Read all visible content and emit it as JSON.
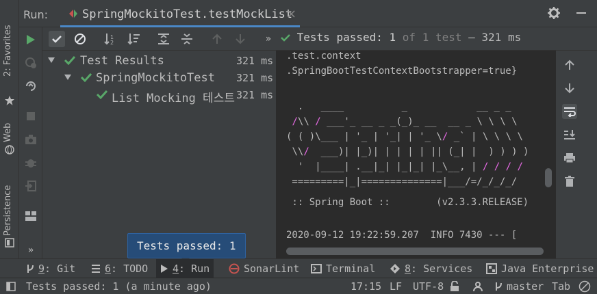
{
  "run_header": {
    "label": "Run:",
    "tab_title": "SpringMockitoTest.testMockList",
    "tab_close": "×"
  },
  "side_tabs": {
    "favorites": "2: Favorites",
    "web": "Web",
    "persistence": "Persistence"
  },
  "toolbar": {
    "expand_more": "»",
    "status_passed": "Tests passed:",
    "status_count": "1",
    "status_of": "of 1 test",
    "status_time": "– 321 ms"
  },
  "left_toolbar": {
    "more": "»"
  },
  "test_tree": [
    {
      "label": "Test Results",
      "duration": "321 ms"
    },
    {
      "label": "SpringMockitoTest",
      "duration": "321 ms"
    },
    {
      "label": "List Mocking 테스트",
      "duration": "321 ms"
    }
  ],
  "console": {
    "lines": [
      ".test.context",
      ".SpringBootTestContextBootstrapper=true}",
      "",
      "  .   ____          _            __ _ _",
      " /\\\\ / ___'_ __ _ _(_)_ __  __ _ \\ \\ \\ \\",
      "( ( )\\___ | '_ | '_| | '_ \\/ _` | \\ \\ \\ \\",
      " \\\\/  ___)| |_)| | | | | || (_| |  ) ) ) )",
      "  '  |____| .__|_| |_|_| |_\\__, | / / / /",
      " =========|_|==============|___/=/_/_/_/",
      " :: Spring Boot ::        (v2.3.3.RELEASE)",
      "",
      "2020-09-12 19:22:59.207  INFO 7430 --- ["
    ]
  },
  "tooltip": {
    "text": "Tests passed: 1"
  },
  "tool_windows": [
    {
      "key": "9",
      "label": "Git",
      "icon": "git-branch-icon"
    },
    {
      "key": "6",
      "label": "TODO",
      "icon": "todo-list-icon"
    },
    {
      "key": "4",
      "label": "Run",
      "icon": "run-icon"
    },
    {
      "key": "",
      "label": "SonarLint",
      "icon": "sonarlint-icon"
    },
    {
      "key": "",
      "label": "Terminal",
      "icon": "terminal-icon"
    },
    {
      "key": "8",
      "label": "Services",
      "icon": "services-icon"
    },
    {
      "key": "",
      "label": "Java Enterprise",
      "icon": "java-enterprise-icon"
    }
  ],
  "status_bar": {
    "message": "Tests passed: 1 (a minute ago)",
    "position": "17:15",
    "line_separator": "LF",
    "encoding": "UTF-8",
    "branch": "master",
    "indent": "Tab"
  },
  "colors": {
    "background": "#2b2b2b",
    "panel": "#3c3f41",
    "accent_blue": "#4a88c7",
    "success_green": "#59a869",
    "banner_pink": "#e96be7"
  }
}
